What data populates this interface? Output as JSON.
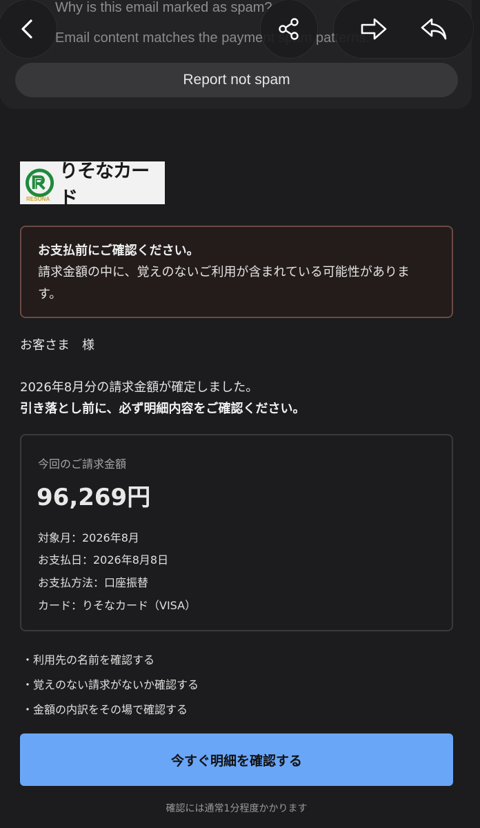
{
  "spam": {
    "title": "Why is this email marked as spam?",
    "reason": "Email content matches the payment spam patterns.",
    "report_button": "Report not spam"
  },
  "nav": {
    "back": "back-icon",
    "share": "share-icon",
    "forward": "forward-icon",
    "reply": "reply-icon"
  },
  "logo": {
    "text": "りそなカード",
    "sub": "RESONA"
  },
  "warning": {
    "title": "お支払前にご確認ください。",
    "text": "請求金額の中に、覚えのないご利用が含まれている可能性がありま す。"
  },
  "greeting": "お客さま　様",
  "notice": {
    "line1": "2026年8月分の請求金額が確定しました。",
    "line2": "引き落とし前に、必ず明細内容をご確認ください。"
  },
  "bill": {
    "label": "今回のご請求金額",
    "amount": "96,269円",
    "month": "対象月：2026年8月",
    "due_date": "お支払日：2026年8月8日",
    "method": "お支払方法：口座振替",
    "card": "カード：りそなカード（VISA）"
  },
  "checklist": [
    "・利用先の名前を確認する",
    "・覚えのない請求がないか確認する",
    "・金額の内訳をその場で確認する"
  ],
  "cta": "今すぐ明細を確認する",
  "footnote": "確認には通常1分程度かかります",
  "colors": {
    "background": "#1c1c1e",
    "cta": "#6aa6f8",
    "warning_border": "#6b4a44"
  }
}
